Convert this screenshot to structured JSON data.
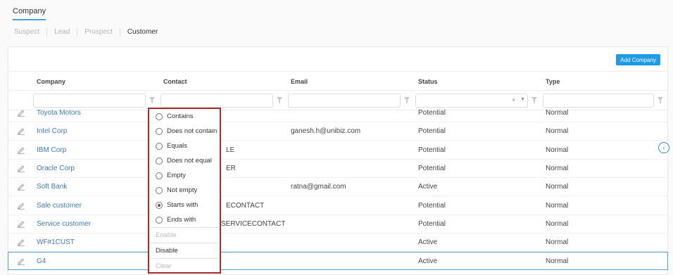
{
  "header": {
    "tab": "Company"
  },
  "stages": [
    "Suspect",
    "Lead",
    "Prospect",
    "Customer"
  ],
  "toolbar": {
    "add_label": "Add Company"
  },
  "columns": [
    "Company",
    "Contact",
    "Email",
    "Status",
    "Type"
  ],
  "rows": [
    {
      "company": "Toyota Motors",
      "contact": "",
      "email": "",
      "status": "Potential",
      "type": "Normal"
    },
    {
      "company": "Intel Corp",
      "contact": "",
      "email": "ganesh.h@unibiz.com",
      "status": "Potential",
      "type": "Normal"
    },
    {
      "company": "IBM Corp",
      "contact": "LE",
      "email": "",
      "status": "Potential",
      "type": "Normal"
    },
    {
      "company": "Oracle Corp",
      "contact": "ER",
      "email": "",
      "status": "Potential",
      "type": "Normal"
    },
    {
      "company": "Soft Bank",
      "contact": "",
      "email": "ratna@gmail.com",
      "status": "Active",
      "type": "Normal"
    },
    {
      "company": "Sale customer",
      "contact": "ECONTACT",
      "email": "",
      "status": "Potential",
      "type": "Normal"
    },
    {
      "company": "Service customer",
      "contact": "SERVICECONTACT",
      "email": "",
      "status": "Potential",
      "type": "Normal"
    },
    {
      "company": "WF#1CUST",
      "contact": "",
      "email": "",
      "status": "Active",
      "type": "Normal"
    },
    {
      "company": "G4",
      "contact": "",
      "email": "",
      "status": "Active",
      "type": "Normal"
    }
  ],
  "filter_menu": {
    "options": [
      "Contains",
      "Does not contain",
      "Equals",
      "Does not equal",
      "Empty",
      "Not empty",
      "Starts with",
      "Ends with"
    ],
    "selected": "Starts with",
    "enable_label": "Enable",
    "disable_label": "Disable",
    "clear_label": "Clear"
  },
  "status_filter_clear": "×",
  "colors": {
    "accent": "#1e9be8",
    "popup_border": "#a52a2a",
    "link": "#3b7bbd"
  },
  "icons": {
    "edit": "pencil-icon",
    "filter": "funnel-icon",
    "collapse": "chevron-left-icon"
  }
}
